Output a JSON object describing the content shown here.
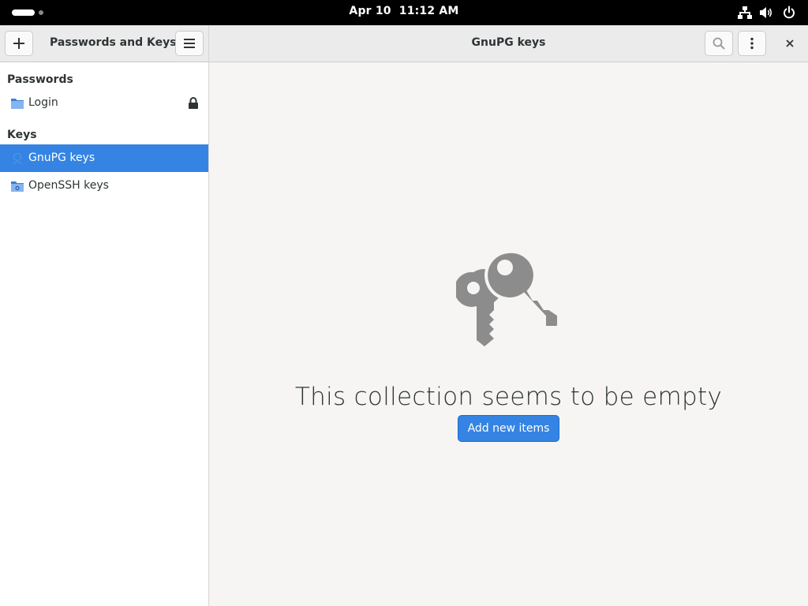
{
  "topbar": {
    "date": "Apr 10",
    "time": "11:12 AM",
    "icons": [
      "network-icon",
      "volume-icon",
      "power-icon"
    ]
  },
  "sidebar": {
    "title": "Passwords and Keys",
    "sections": [
      {
        "label": "Passwords",
        "items": [
          {
            "label": "Login",
            "icon": "folder-icon",
            "locked": true
          }
        ]
      },
      {
        "label": "Keys",
        "items": [
          {
            "label": "GnuPG keys",
            "icon": "gnupg-icon",
            "selected": true
          },
          {
            "label": "OpenSSH keys",
            "icon": "ssh-folder-icon"
          }
        ]
      }
    ]
  },
  "content": {
    "title": "GnuPG keys",
    "empty_message": "This collection seems to be empty",
    "add_button": "Add new items"
  },
  "colors": {
    "accent": "#3584e4",
    "topbar": "#000000",
    "header": "#ebebeb",
    "content_bg": "#f6f5f4",
    "empty_icon": "#8c8c8c"
  }
}
